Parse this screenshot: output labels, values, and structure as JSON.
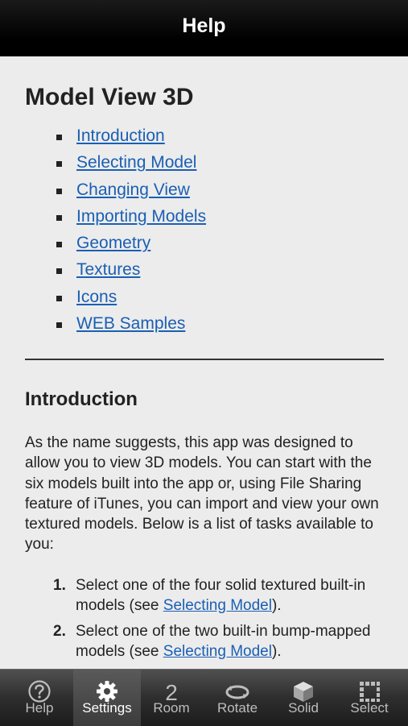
{
  "navbar": {
    "title": "Help"
  },
  "main": {
    "heading": "Model View 3D",
    "toc": [
      "Introduction",
      "Selecting Model",
      "Changing View",
      "Importing Models",
      "Geometry",
      "Textures",
      "Icons",
      "WEB Samples"
    ],
    "intro_heading": "Introduction",
    "intro_text": "As the name suggests, this app was designed to allow you to view 3D models. You can start with the six models built into the app or, using File Sharing feature of iTunes, you can import and view your own textured models. Below is a list of tasks available to you:",
    "tasks": [
      {
        "num": "1.",
        "before": "Select one of the four solid textured built-in models (see ",
        "link": "Selecting Model",
        "after": ")."
      },
      {
        "num": "2.",
        "before": "Select one of the two built-in bump-mapped models (see ",
        "link": "Selecting Model",
        "after": ")."
      }
    ]
  },
  "tabbar": {
    "tabs": [
      {
        "label": "Help",
        "icon": "question-circle-icon"
      },
      {
        "label": "Settings",
        "icon": "gear-icon"
      },
      {
        "label": "Room",
        "icon": "number-2-icon",
        "glyph": "2"
      },
      {
        "label": "Rotate",
        "icon": "rotate-arrows-icon"
      },
      {
        "label": "Solid",
        "icon": "cube-icon"
      },
      {
        "label": "Select",
        "icon": "dotted-square-icon"
      }
    ],
    "selected": "Settings"
  }
}
